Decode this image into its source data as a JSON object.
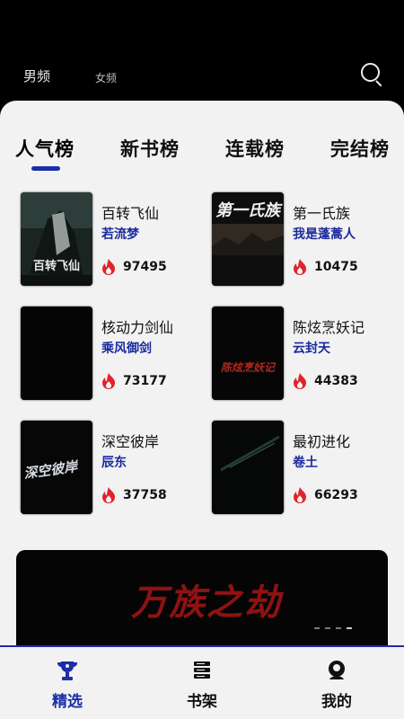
{
  "top": {
    "tabs": [
      "男频",
      "女频"
    ],
    "search_icon": "search-icon"
  },
  "rank_tabs": [
    "人气榜",
    "新书榜",
    "连载榜",
    "完结榜"
  ],
  "books": [
    {
      "title": "百转飞仙",
      "author": "若流梦",
      "heat": "97495"
    },
    {
      "title": "第一氏族",
      "author": "我是蓬蒿人",
      "heat": "10475"
    },
    {
      "title": "核动力剑仙",
      "author": "乘风御剑",
      "heat": "73177"
    },
    {
      "title": "陈炫烹妖记",
      "author": "云封天",
      "heat": "44383"
    },
    {
      "title": "深空彼岸",
      "author": "辰东",
      "heat": "37758"
    },
    {
      "title": "最初进化",
      "author": "卷土",
      "heat": "66293"
    }
  ],
  "covers": {
    "c1": "百转飞仙",
    "c2": "第一氏族",
    "c4": "陈炫烹妖记",
    "c5": "深空彼岸"
  },
  "banner": {
    "text": "万族之劫"
  },
  "bottom_nav": [
    {
      "label": "精选",
      "icon": "trophy-icon"
    },
    {
      "label": "书架",
      "icon": "bookshelf-icon"
    },
    {
      "label": "我的",
      "icon": "profile-icon"
    }
  ],
  "colors": {
    "accent": "#1c2ea8",
    "fire": "#e0242c",
    "panel": "#f2f2f2"
  }
}
